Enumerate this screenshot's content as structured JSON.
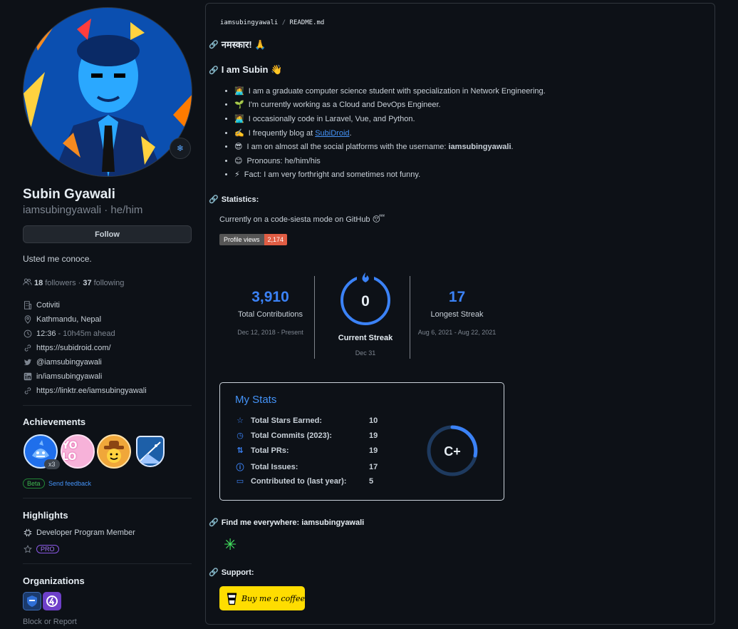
{
  "profile": {
    "name": "Subin Gyawali",
    "handle": "iamsubingyawali · he/him",
    "follow_label": "Follow",
    "bio": "Usted me conoce.",
    "followers_count": "18",
    "followers_label": "followers",
    "separator": "·",
    "following_count": "37",
    "following_label": "following",
    "company": "Cotiviti",
    "location": "Kathmandu, Nepal",
    "time": "12:36",
    "time_note": "- 10h45m ahead",
    "website": "https://subidroid.com/",
    "twitter": "@iamsubingyawali",
    "linkedin": "in/iamsubingyawali",
    "linktree": "https://linktr.ee/iamsubingyawali"
  },
  "achievements": {
    "title": "Achievements",
    "multiplier": "x3",
    "beta": "Beta",
    "feedback": "Send feedback"
  },
  "highlights": {
    "title": "Highlights",
    "program": "Developer Program Member",
    "pro": "PRO"
  },
  "organizations": {
    "title": "Organizations",
    "block": "Block or Report"
  },
  "readme": {
    "crumb_user": "iamsubingyawali",
    "crumb_sep": "/",
    "crumb_file": "README.md",
    "greeting": "नमस्कार! 🙏",
    "intro": "I am Subin 👋",
    "bullets": [
      {
        "emoji": "👩‍💻",
        "text": "I am a graduate computer science student with specialization in Network Engineering."
      },
      {
        "emoji": "🌱",
        "text": "I'm currently working as a Cloud and DevOps Engineer."
      },
      {
        "emoji": "🧑‍💻",
        "text": "I occasionally code in Laravel, Vue, and Python."
      },
      {
        "emoji": "✍️",
        "text": "I frequently blog at"
      },
      {
        "emoji": "😎",
        "text": "I am on almost all the social platforms with the username:"
      },
      {
        "emoji": "😊",
        "text": "Pronouns: he/him/his"
      },
      {
        "emoji": "⚡",
        "text": "Fact: I am very forthright and sometimes not funny."
      }
    ],
    "blog_link": "SubiDroid",
    "blog_suffix": ".",
    "username_bold": "iamsubingyawali",
    "username_suffix": ".",
    "stats_heading": "Statistics:",
    "siesta": "Currently on a code-siesta mode on GitHub 😴",
    "views_label": "Profile views",
    "views_value": "2,174",
    "find_heading": "Find me everywhere: iamsubingyawali",
    "support_heading": "Support:",
    "coffee_label": "Buy me a coffee"
  },
  "streak": {
    "total": "3,910",
    "total_label": "Total Contributions",
    "total_range": "Dec 12, 2018 - Present",
    "current": "0",
    "current_label": "Current Streak",
    "current_date": "Dec 31",
    "longest": "17",
    "longest_label": "Longest Streak",
    "longest_range": "Aug 6, 2021 - Aug 22, 2021",
    "accent": "#3b82f6"
  },
  "mystats": {
    "title": "My Stats",
    "rows": [
      {
        "icon": "star-icon",
        "label": "Total Stars Earned:",
        "value": "10"
      },
      {
        "icon": "history-icon",
        "label": "Total Commits (2023):",
        "value": "19"
      },
      {
        "icon": "pull-request-icon",
        "label": "Total PRs:",
        "value": "19"
      },
      {
        "icon": "issue-icon",
        "label": "Total Issues:",
        "value": "17"
      },
      {
        "icon": "repo-icon",
        "label": "Contributed to (last year):",
        "value": "5"
      }
    ],
    "grade": "C+"
  },
  "colors": {
    "background": "#0d1117",
    "link": "#4493f8",
    "coffee": "#ffdd00",
    "views_badge": "#e05d44"
  }
}
